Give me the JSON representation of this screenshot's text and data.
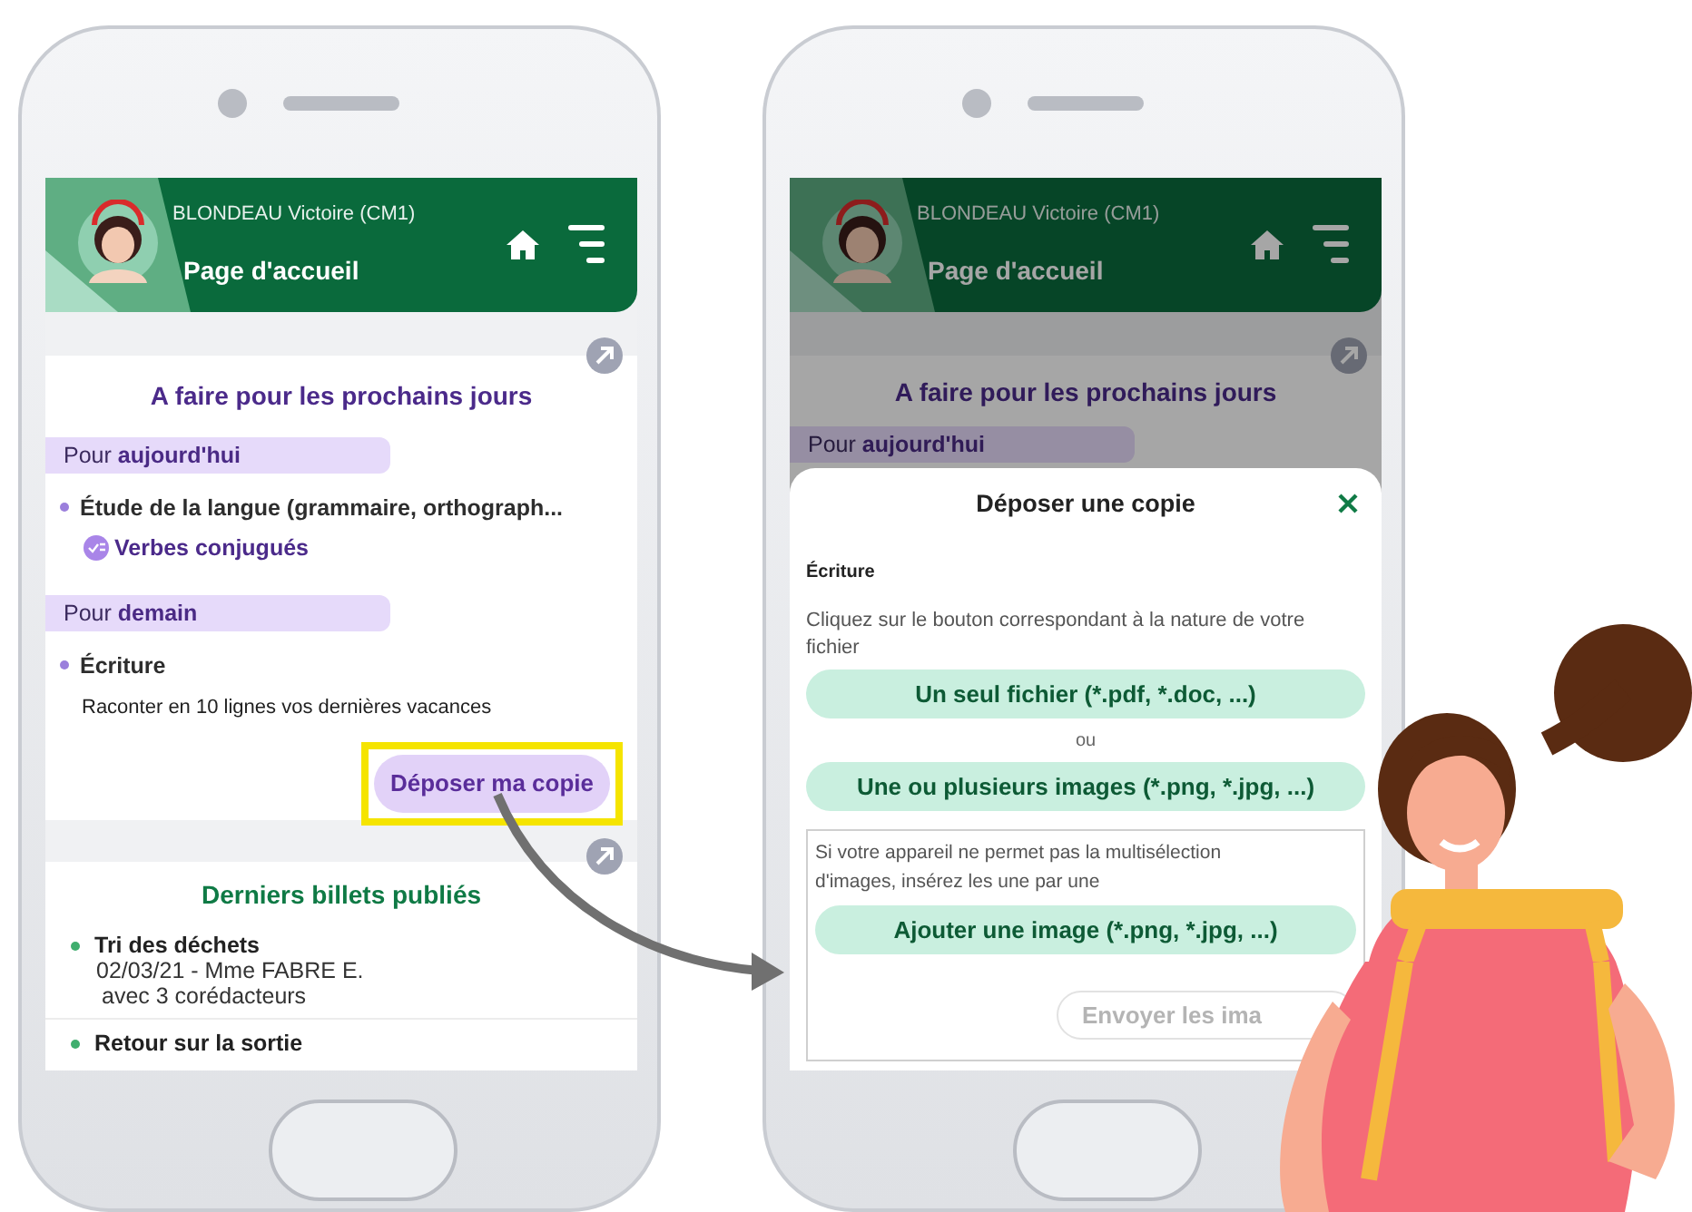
{
  "home_screen": {
    "header": {
      "student": "BLONDEAU Victoire (CM1)",
      "title": "Page d'accueil"
    },
    "homework": {
      "title": "A faire pour les prochains jours",
      "groups": [
        {
          "label": "Pour **aujourd'hui**",
          "items": [
            {
              "subject": "Étude de la langue (grammaire, orthograph...",
              "link": "Verbes conjugués"
            }
          ]
        },
        {
          "label": "Pour **demain**",
          "items": [
            {
              "subject": "Écriture",
              "description": "Raconter en 10 lignes vos dernières vacances",
              "action": {
                "label": "Déposer ma copie",
                "highlighted": true
              }
            }
          ]
        }
      ]
    },
    "blog": {
      "title": "Derniers billets publiés",
      "posts": [
        {
          "title": "Tri des déchets",
          "meta": "02/03/21 - Mme FABRE E.",
          "coauthors": "avec 3 corédacteurs"
        },
        {
          "title": "Retour sur la sortie"
        }
      ]
    }
  },
  "upload_screen": {
    "header": {
      "student": "BLONDEAU Victoire (CM1)",
      "title": "Page d'accueil"
    },
    "homework_title": "A faire pour les prochains jours",
    "group_label": "Pour **aujourd'hui**",
    "dialog": {
      "title": "Déposer une copie",
      "subject": "Écriture",
      "instructions": "Cliquez sur le bouton correspondant à la nature de votre fichier",
      "file_button": "Un seul fichier (*.pdf, *.doc, ...)",
      "separator": "ou",
      "images_button": "Une ou plusieurs images (*.png, *.jpg, ...)",
      "fallback": {
        "note": "Si votre appareil ne permet pas la multisélection d'images, insérez les une par une",
        "add_button": "Ajouter une image (*.png, *.jpg, ...)",
        "send_button": {
          "label": "Envoyer les ima",
          "disabled": true
        }
      }
    }
  }
}
